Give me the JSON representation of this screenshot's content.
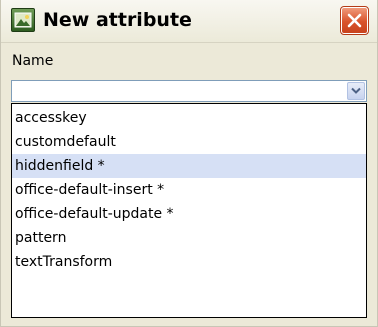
{
  "dialog": {
    "title": "New attribute",
    "app_icon": "image-icon",
    "close_icon": "close-icon"
  },
  "form": {
    "name_label": "Name",
    "name_value": "",
    "dropdown_icon": "chevron-down-icon"
  },
  "dropdown": {
    "items": [
      {
        "label": "accesskey",
        "selected": false
      },
      {
        "label": "customdefault",
        "selected": false
      },
      {
        "label": "hiddenfield *",
        "selected": true
      },
      {
        "label": "office-default-insert *",
        "selected": false
      },
      {
        "label": "office-default-update *",
        "selected": false
      },
      {
        "label": "pattern",
        "selected": false
      },
      {
        "label": "textTransform",
        "selected": false
      }
    ]
  },
  "colors": {
    "close_button": "#d9532b",
    "selection_highlight": "#d6e0f5",
    "dialog_background": "#ece9d8"
  }
}
